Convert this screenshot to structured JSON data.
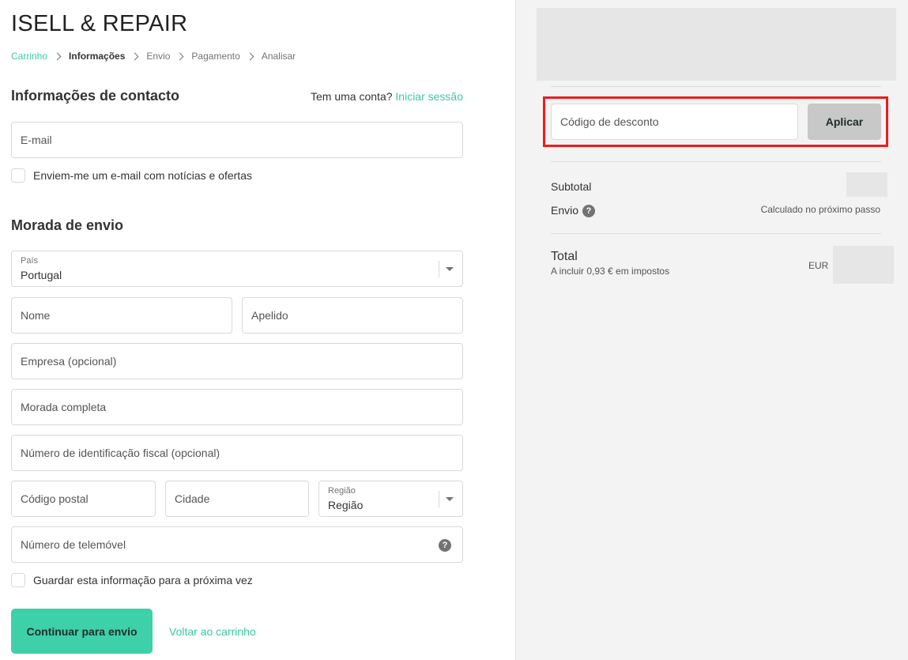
{
  "store": {
    "name": "ISELL & REPAIR"
  },
  "breadcrumb": [
    {
      "label": "Carrinho"
    },
    {
      "label": "Informações"
    },
    {
      "label": "Envio"
    },
    {
      "label": "Pagamento"
    },
    {
      "label": "Analisar"
    }
  ],
  "contact": {
    "title": "Informações de contacto",
    "account_prompt": "Tem uma conta?",
    "login_link": "Iniciar sessão",
    "email_placeholder": "E-mail",
    "newsletter_label": "Enviem-me um e-mail com notícias e ofertas"
  },
  "shipping": {
    "title": "Morada de envio",
    "country": {
      "label": "País",
      "value": "Portugal"
    },
    "first_name_placeholder": "Nome",
    "last_name_placeholder": "Apelido",
    "company_placeholder": "Empresa (opcional)",
    "address_placeholder": "Morada completa",
    "tax_id_placeholder": "Número de identificação fiscal (opcional)",
    "postal_code_placeholder": "Código postal",
    "city_placeholder": "Cidade",
    "region": {
      "label": "Região",
      "value": "Região"
    },
    "phone_placeholder": "Número de telemóvel",
    "save_info_label": "Guardar esta informação para a próxima vez"
  },
  "actions": {
    "continue_label": "Continuar para envio",
    "back_label": "Voltar ao carrinho"
  },
  "summary": {
    "discount_placeholder": "Código de desconto",
    "apply_label": "Aplicar",
    "subtotal_label": "Subtotal",
    "shipping_label": "Envio",
    "shipping_note": "Calculado no próximo passo",
    "total_label": "Total",
    "tax_note": "A incluir 0,93 € em impostos",
    "currency": "EUR"
  },
  "colors": {
    "accent": "#3bc9a4",
    "primary_button": "#3ed0a8",
    "highlight": "#ee1c1c",
    "sidebar_bg": "#f3f3f3"
  },
  "icons": {
    "breadcrumb_separator": "chevron-right-icon",
    "help": "question-circle-icon",
    "select": "caret-down-icon"
  }
}
